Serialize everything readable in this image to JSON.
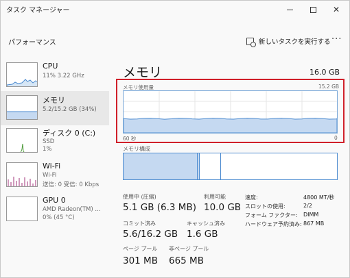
{
  "window": {
    "title": "タスク マネージャー"
  },
  "header": {
    "title": "パフォーマンス",
    "run_task": "新しいタスクを実行する",
    "more": "···"
  },
  "sidebar": {
    "items": [
      {
        "name": "CPU",
        "sub1": "11%  3.22 GHz",
        "sub2": "",
        "sub3": ""
      },
      {
        "name": "メモリ",
        "sub1": "5.2/15.2 GB (34%)",
        "sub2": "",
        "sub3": ""
      },
      {
        "name": "ディスク 0 (C:)",
        "sub1": "SSD",
        "sub2": "1%",
        "sub3": ""
      },
      {
        "name": "Wi-Fi",
        "sub1": "Wi-Fi",
        "sub2": "送信: 0  受信: 0 Kbps",
        "sub3": ""
      },
      {
        "name": "GPU 0",
        "sub1": "AMD Radeon(TM) ...",
        "sub2": "0%  (45 °C)",
        "sub3": ""
      }
    ]
  },
  "main": {
    "title": "メモリ",
    "total": "16.0 GB",
    "graph": {
      "label": "メモリ使用量",
      "max": "15.2 GB",
      "time_left": "60 秒",
      "time_right": "0",
      "level": 0.34
    },
    "composition": {
      "label": "メモリ構成"
    },
    "stats": [
      {
        "label": "使用中 (圧縮)",
        "value": "5.1 GB (6.3 MB)"
      },
      {
        "label": "利用可能",
        "value": "10.0 GB"
      },
      {
        "label": "コミット済み",
        "value": "5.6/16.2 GB"
      },
      {
        "label": "キャッシュ済み",
        "value": "1.6 GB"
      },
      {
        "label": "ページ プール",
        "value": "301 MB"
      },
      {
        "label": "非ページ プール",
        "value": "665 MB"
      }
    ],
    "details": [
      {
        "key": "速度:",
        "value": "4800 MT/秒"
      },
      {
        "key": "スロットの使用:",
        "value": "2/2"
      },
      {
        "key": "フォーム ファクター:",
        "value": "DIMM"
      },
      {
        "key": "ハードウェア予約済み:",
        "value": "867 MB"
      }
    ]
  },
  "colors": {
    "accent": "#4c8bd0",
    "fill": "#c5d9f1",
    "highlight": "#d0202a"
  }
}
